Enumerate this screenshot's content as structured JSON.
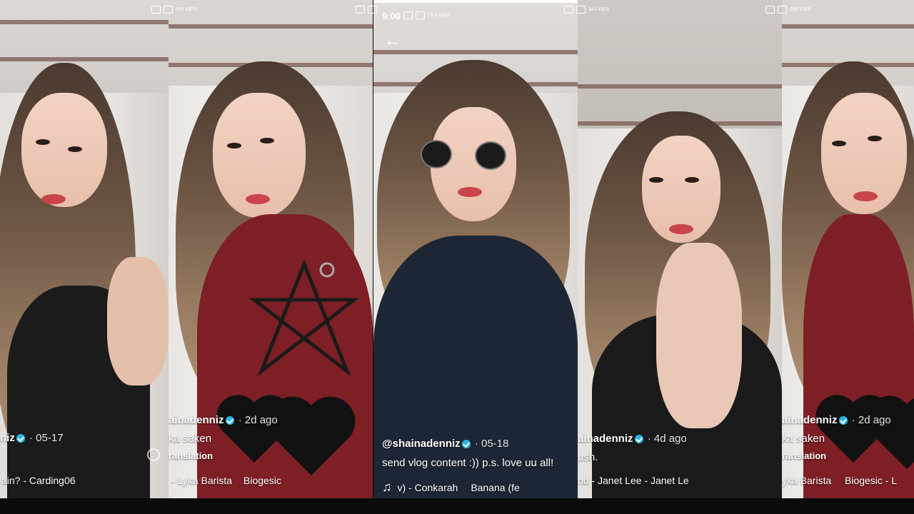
{
  "status_bar": {
    "time": "9:00",
    "speeds": [
      "299 KB/S",
      "",
      "29.0 KB/S",
      "344 KB/S",
      "288 KB/S"
    ]
  },
  "panels": [
    {
      "handle": "niz",
      "date": "· 05-17",
      "caption": "",
      "subcaption": "",
      "music": "ain? - Carding06",
      "music2": ""
    },
    {
      "handle": "ainadenniz",
      "date": "· 2d ago",
      "caption": "ka saken",
      "subcaption": "ranslation",
      "music": "- Lyka Barista",
      "music2": "Biogesic"
    },
    {
      "handle": "@shainadenniz",
      "date": "· 05-18",
      "caption": "send vlog content :)) p.s. love uu all!",
      "subcaption": "",
      "music": "v) - Conkarah",
      "music2": "Banana (fe"
    },
    {
      "handle": "ainadenniz",
      "date": "· 4d ago",
      "caption": "ush.",
      "subcaption": "",
      "music": "nd - Janet Lee - Janet Le",
      "music2": ""
    },
    {
      "handle": "ainadenniz",
      "date": "· 2d ago",
      "caption": "ka saken",
      "subcaption": "ranslation",
      "music": "yka Barista",
      "music2": "Biogesic - L"
    }
  ],
  "icons": {
    "music_note": "♫",
    "back_arrow": "←",
    "verified": "verified-badge-icon",
    "heart": "black-heart-emoji"
  },
  "colors": {
    "verified": "#2ab6e8",
    "background": "#0b0b0b"
  }
}
